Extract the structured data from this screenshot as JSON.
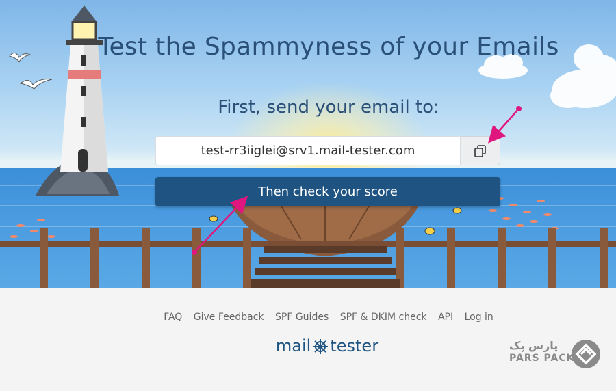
{
  "hero": {
    "title": "Test the Spammyness of your Emails",
    "subtitle": "First, send your email to:",
    "email_address": "test-rr3iiglei@srv1.mail-tester.com",
    "check_button_label": "Then check your score",
    "copy_icon": "copy-icon"
  },
  "footer": {
    "links": [
      "FAQ",
      "Give Feedback",
      "SPF Guides",
      "SPF & DKIM check",
      "API",
      "Log in"
    ],
    "logo_left": "mail",
    "logo_right": "tester"
  },
  "watermark": {
    "persian": "پارس پک",
    "latin": "PARS PACK"
  },
  "colors": {
    "primary": "#1f5482",
    "title": "#2a5078",
    "annotation_arrow": "#e0167f"
  }
}
